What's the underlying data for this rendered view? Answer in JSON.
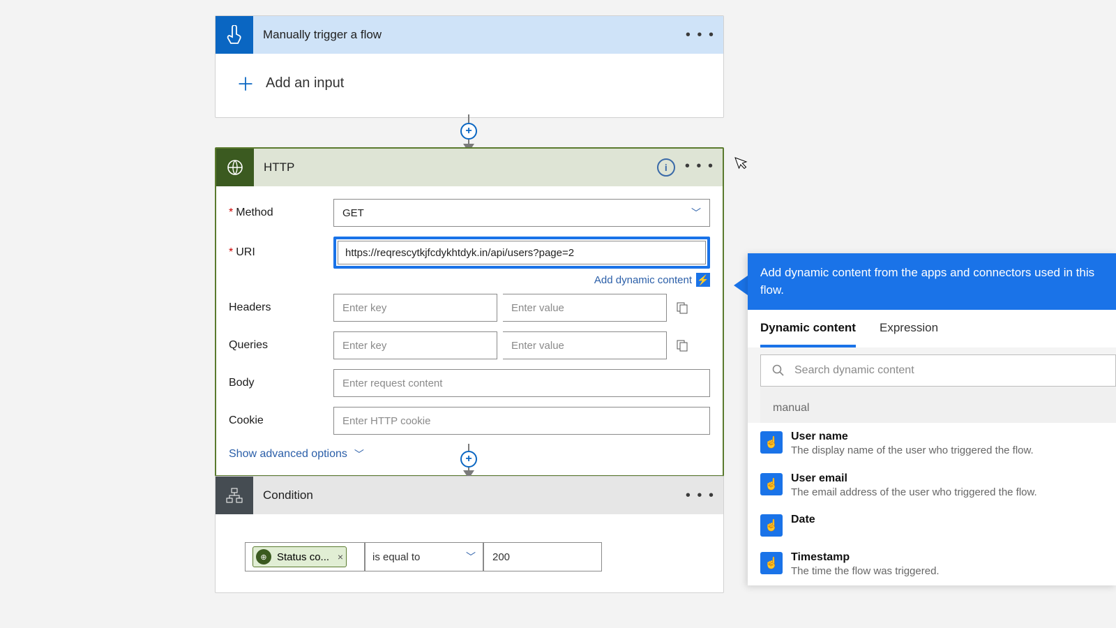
{
  "trigger": {
    "title": "Manually trigger a flow",
    "add_input_label": "Add an input"
  },
  "http": {
    "title": "HTTP",
    "method_label": "Method",
    "method_value": "GET",
    "uri_label": "URI",
    "uri_value": "https://reqrescytkjfcdykhtdyk.in/api/users?page=2",
    "add_dynamic_link": "Add dynamic content",
    "headers_label": "Headers",
    "key_placeholder": "Enter key",
    "value_placeholder": "Enter value",
    "queries_label": "Queries",
    "body_label": "Body",
    "body_placeholder": "Enter request content",
    "cookie_label": "Cookie",
    "cookie_placeholder": "Enter HTTP cookie",
    "show_advanced": "Show advanced options"
  },
  "condition": {
    "title": "Condition",
    "left_token": "Status co...",
    "operator": "is equal to",
    "value": "200"
  },
  "dynamic": {
    "head": "Add dynamic content from the apps and connectors used in this flow.",
    "tab_dynamic": "Dynamic content",
    "tab_expression": "Expression",
    "search_placeholder": "Search dynamic content",
    "section_label": "manual",
    "items": [
      {
        "title": "User name",
        "desc": "The display name of the user who triggered the flow."
      },
      {
        "title": "User email",
        "desc": "The email address of the user who triggered the flow."
      },
      {
        "title": "Date",
        "desc": ""
      },
      {
        "title": "Timestamp",
        "desc": "The time the flow was triggered."
      }
    ]
  }
}
